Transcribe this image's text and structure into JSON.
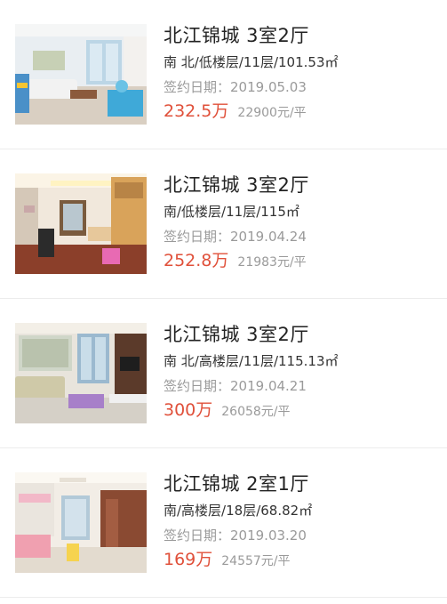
{
  "listings": [
    {
      "title": "北江锦城 3室2厅",
      "details": "南 北/低楼层/11层/101.53㎡",
      "date": "签约日期：2019.05.03",
      "price": "232.5万",
      "unit_price": "22900元/平",
      "photo_icon": "living-room-photo"
    },
    {
      "title": "北江锦城 3室2厅",
      "details": "南/低楼层/11层/115㎡",
      "date": "签约日期：2019.04.24",
      "price": "252.8万",
      "unit_price": "21983元/平",
      "photo_icon": "living-room-photo"
    },
    {
      "title": "北江锦城 3室2厅",
      "details": "南 北/高楼层/11层/115.13㎡",
      "date": "签约日期：2019.04.21",
      "price": "300万",
      "unit_price": "26058元/平",
      "photo_icon": "living-room-photo"
    },
    {
      "title": "北江锦城 2室1厅",
      "details": "南/高楼层/18层/68.82㎡",
      "date": "签约日期：2019.03.20",
      "price": "169万",
      "unit_price": "24557元/平",
      "photo_icon": "living-room-photo"
    }
  ],
  "colors": {
    "price": "#e0503a",
    "secondary_text": "#9a9a9a",
    "title_text": "#222222"
  }
}
